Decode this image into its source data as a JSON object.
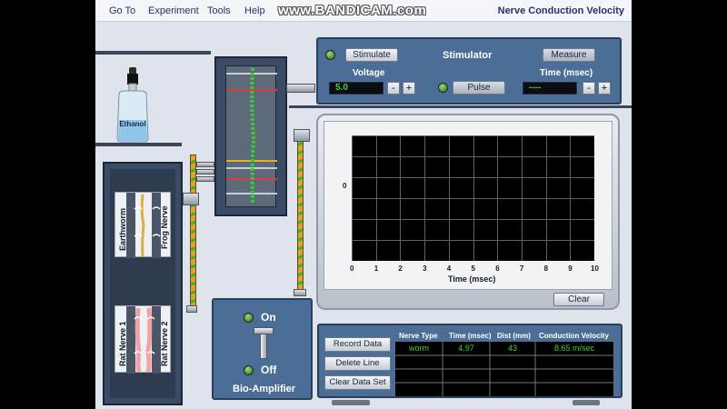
{
  "menu": {
    "items": [
      "Go To",
      "Experiment",
      "Tools",
      "Help"
    ],
    "watermark": "www.BANDICAM.com",
    "title": "Nerve Conduction Velocity"
  },
  "ethanol": {
    "label": "Ethanol"
  },
  "nerves": {
    "earthworm_label": "Earthworm",
    "frog_label": "Frog Nerve",
    "rat1_label": "Rat Nerve 1",
    "rat2_label": "Rat Nerve 2"
  },
  "stimulator": {
    "stimulate_label": "Stimulate",
    "title": "Stimulator",
    "measure_label": "Measure",
    "voltage_label": "Voltage",
    "voltage_value": "5.0",
    "pulse_label": "Pulse",
    "time_label": "Time (msec)",
    "time_value": "----",
    "minus": "-",
    "plus": "+"
  },
  "oscilloscope": {
    "y_label": "0",
    "x_ticks": [
      "0",
      "1",
      "2",
      "3",
      "4",
      "5",
      "6",
      "7",
      "8",
      "9",
      "10"
    ],
    "x_label": "Time (msec)",
    "clear_label": "Clear"
  },
  "bioamp": {
    "on_label": "On",
    "off_label": "Off",
    "title": "Bio-Amplifier"
  },
  "data": {
    "record_label": "Record Data",
    "delete_label": "Delete Line",
    "clear_set_label": "Clear Data Set",
    "headers": [
      "Nerve Type",
      "Time (msec)",
      "Dist (mm)",
      "Conduction Velocity"
    ],
    "rows": [
      [
        "worm",
        "4.97",
        "43",
        "8.65 m/sec"
      ]
    ]
  },
  "colors": {
    "panel": "#4c6d96",
    "screen": "#000000",
    "led_green": "#3fd23a"
  }
}
